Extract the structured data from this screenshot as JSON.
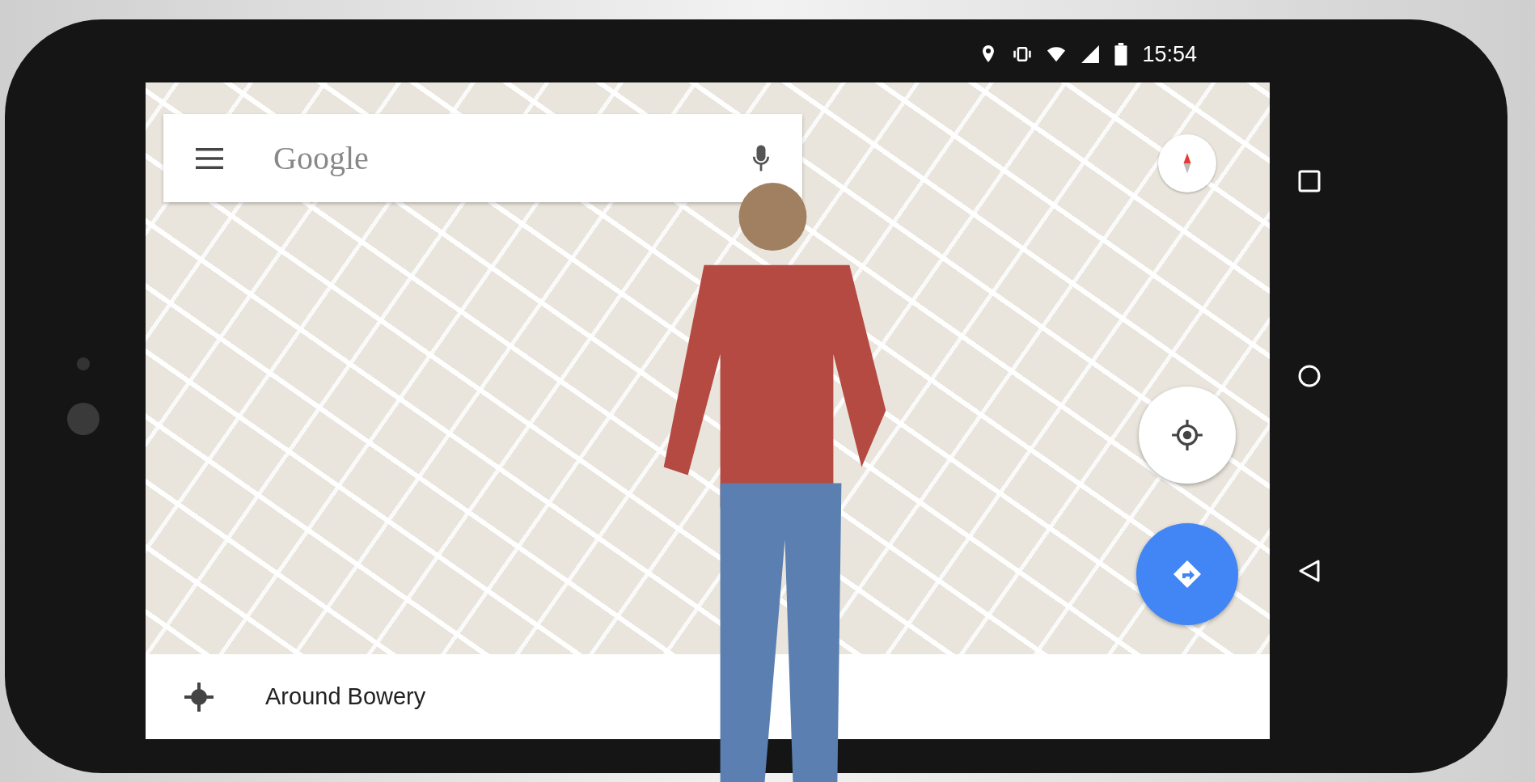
{
  "status_bar": {
    "time": "15:54"
  },
  "search": {
    "placeholder": "Google"
  },
  "place_bar": {
    "label": "Around Bowery"
  }
}
